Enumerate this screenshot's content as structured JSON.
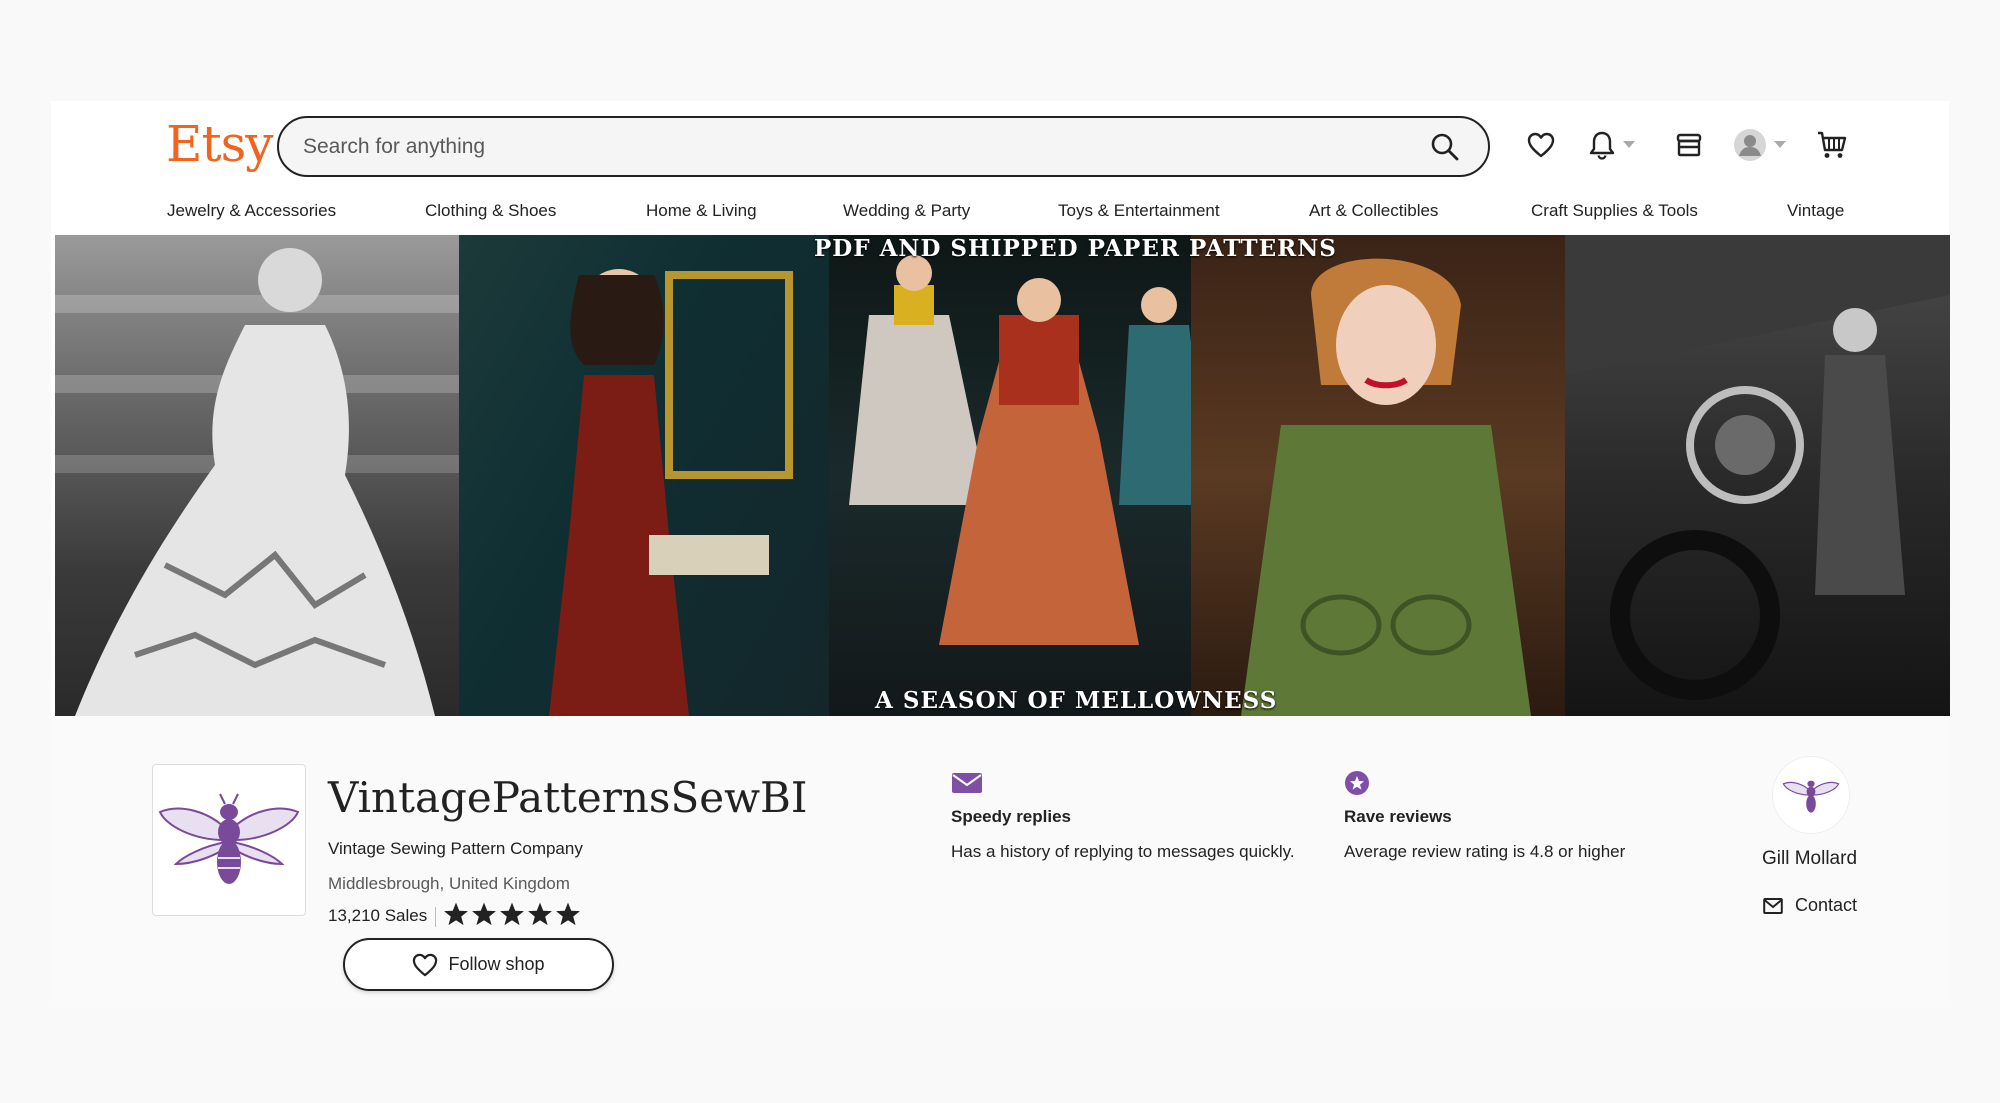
{
  "header": {
    "logo": "Etsy",
    "search_placeholder": "Search for anything"
  },
  "icons": {
    "search": "search-icon",
    "favorites": "heart-icon",
    "notifications": "bell-icon",
    "shop_manager": "shop-icon",
    "account": "avatar-icon",
    "cart": "cart-icon"
  },
  "nav": {
    "items": [
      "Jewelry & Accessories",
      "Clothing & Shoes",
      "Home & Living",
      "Wedding & Party",
      "Toys & Entertainment",
      "Art & Collectibles",
      "Craft Supplies & Tools",
      "Vintage"
    ]
  },
  "banner": {
    "top_text": "PDF AND SHIPPED PAPER PATTERNS",
    "bottom_text": "A SEASON OF MELLOWNESS"
  },
  "shop": {
    "name": "VintagePatternsSewBI",
    "tagline": "Vintage Sewing Pattern Company",
    "location": "Middlesbrough, United Kingdom",
    "sales": "13,210 Sales",
    "rating_stars": 5,
    "follow_label": "Follow shop"
  },
  "badges": [
    {
      "title": "Speedy replies",
      "description": "Has a history of replying to messages quickly."
    },
    {
      "title": "Rave reviews",
      "description": "Average review rating is 4.8 or higher"
    }
  ],
  "owner": {
    "name": "Gill Mollard",
    "contact_label": "Contact"
  },
  "colors": {
    "brand": "#f1641e",
    "badge_purple": "#7f4fa8",
    "bee_purple": "#7a4a9a"
  }
}
